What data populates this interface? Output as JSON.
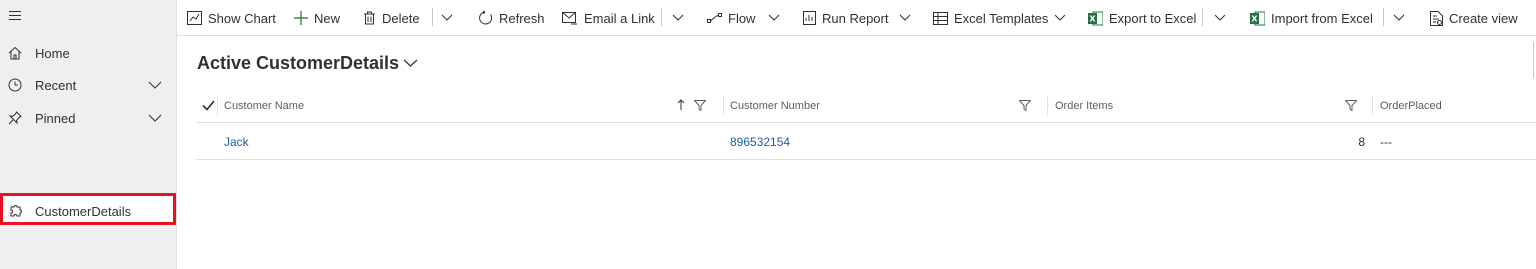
{
  "sidebar": {
    "items": [
      {
        "label": "Home",
        "icon": "home-icon"
      },
      {
        "label": "Recent",
        "icon": "clock-icon"
      },
      {
        "label": "Pinned",
        "icon": "pin-icon"
      }
    ],
    "entity": {
      "label": "CustomerDetails",
      "icon": "puzzle-icon"
    }
  },
  "toolbar": {
    "show_chart": "Show Chart",
    "new": "New",
    "delete": "Delete",
    "refresh": "Refresh",
    "email_link": "Email a Link",
    "flow": "Flow",
    "run_report": "Run Report",
    "excel_templates": "Excel Templates",
    "export_excel": "Export to Excel",
    "import_excel": "Import from Excel",
    "create_view": "Create view"
  },
  "view": {
    "title": "Active CustomerDetails"
  },
  "grid": {
    "columns": [
      "Customer Name",
      "Customer Number",
      "Order Items",
      "OrderPlaced"
    ],
    "rows": [
      {
        "customer_name": "Jack",
        "customer_number": "896532154",
        "order_items": "8",
        "order_placed": "---"
      }
    ]
  },
  "colors": {
    "accent": "#1a5ea8",
    "highlight_border": "#e81123",
    "excel_green": "#217346"
  }
}
